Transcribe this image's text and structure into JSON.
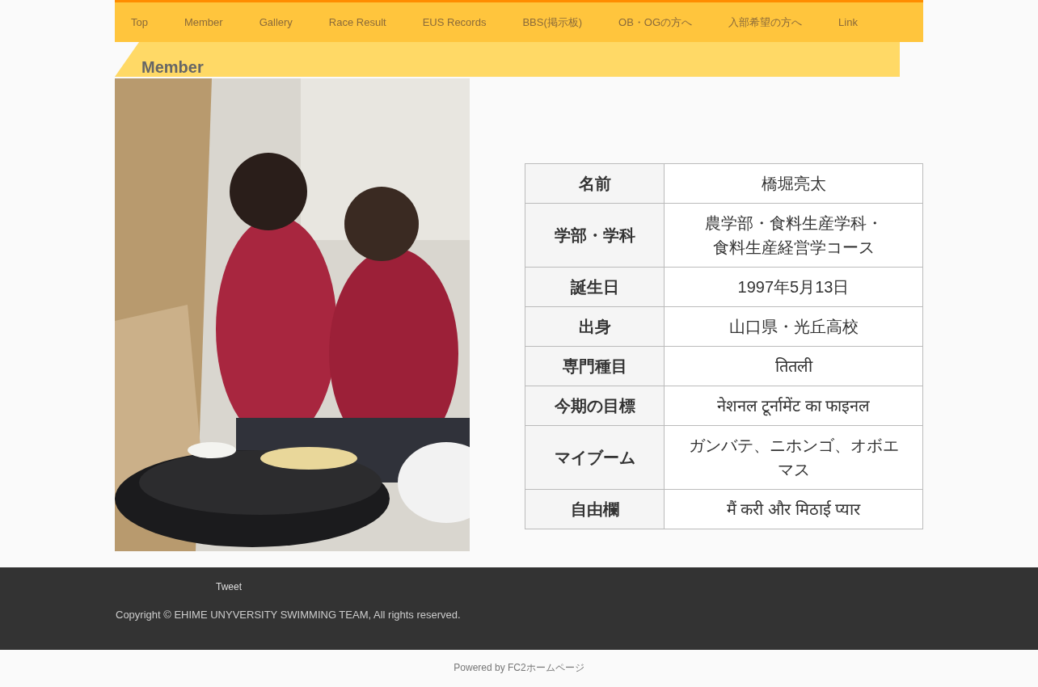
{
  "nav": [
    {
      "label": "Top"
    },
    {
      "label": "Member"
    },
    {
      "label": "Gallery"
    },
    {
      "label": "Race Result"
    },
    {
      "label": "EUS Records"
    },
    {
      "label": "BBS(掲示板)"
    },
    {
      "label": "OB・OGの方へ"
    },
    {
      "label": "入部希望の方へ"
    },
    {
      "label": "Link"
    }
  ],
  "heading": "Member",
  "profile": [
    {
      "label": "名前",
      "lines": [
        "橋堀亮太"
      ]
    },
    {
      "label": "学部・学科",
      "lines": [
        "農学部・食料生産学科・",
        "食料生産経営学コース"
      ]
    },
    {
      "label": "誕生日",
      "lines": [
        "1997年5月13日"
      ]
    },
    {
      "label": "出身",
      "lines": [
        "山口県・光丘高校"
      ]
    },
    {
      "label": "専門種目",
      "lines": [
        "तितली"
      ]
    },
    {
      "label": "今期の目標",
      "lines": [
        "नेशनल टूर्नामेंट का फाइनल"
      ]
    },
    {
      "label": "マイブーム",
      "lines": [
        "ガンバテ、ニホンゴ、オボエ",
        "マス"
      ]
    },
    {
      "label": "自由欄",
      "lines": [
        "मैं करी और मिठाई प्यार"
      ]
    }
  ],
  "footer": {
    "tweet": "Tweet",
    "copyright": "Copyright © EHIME UNYVERSITY SWIMMING TEAM, All rights reserved."
  },
  "powered": "Powered by FC2ホームページ"
}
